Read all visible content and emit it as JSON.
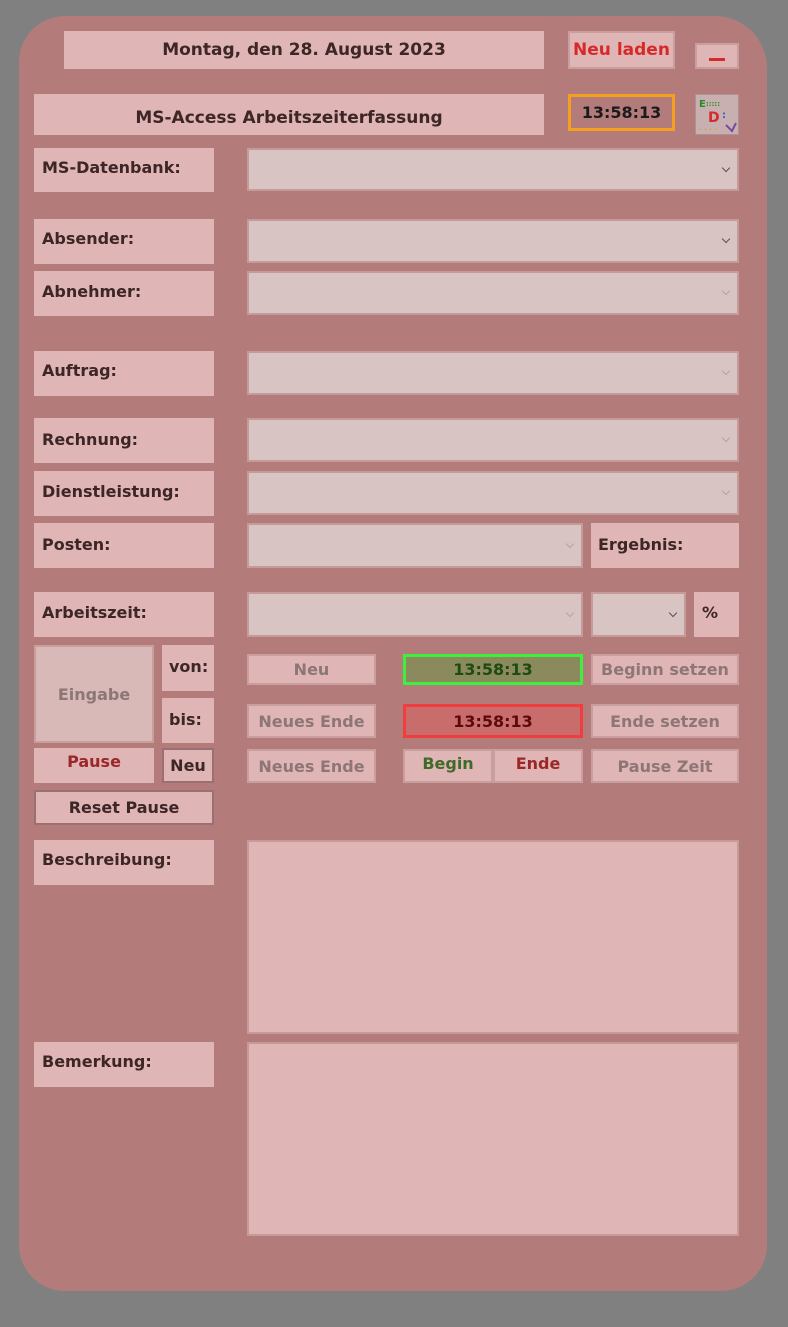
{
  "header": {
    "date_text": "Montag, den 28. August 2023",
    "reload_label": "Neu laden",
    "minimize_label": "—",
    "app_title": "MS-Access Arbeitszeiterfassung",
    "clock": "13:58:13",
    "logo_icon": "form-logo-icon"
  },
  "fields": {
    "database": "MS-Datenbank:",
    "sender": "Absender:",
    "customer": "Abnehmer:",
    "order": "Auftrag:",
    "invoice": "Rechnung:",
    "service": "Dienstleistung:",
    "item": "Posten:",
    "result": "Ergebnis:",
    "worktime": "Arbeitszeit:",
    "percent": "%"
  },
  "time": {
    "input_label": "Eingabe",
    "from_label": "von:",
    "to_label": "bis:",
    "pause_label": "Pause",
    "pause_new_label": "Neu",
    "reset_pause_label": "Reset Pause",
    "new_label": "Neu",
    "new_end_label": "Neues Ende",
    "new_end_label_2": "Neues Ende",
    "start_clock": "13:58:13",
    "end_clock": "13:58:13",
    "begin_label": "Begin",
    "end_label": "Ende",
    "set_begin_label": "Beginn setzen",
    "set_end_label": "Ende setzen",
    "pause_time_label": "Pause Zeit"
  },
  "text": {
    "description_label": "Beschreibung:",
    "remark_label": "Bemerkung:"
  },
  "colors": {
    "panel": "#b47b7b",
    "label_bg": "#e0b5b5",
    "accent_red": "#d62a2a",
    "clock_green_border": "#3ef03e",
    "clock_red_border": "#f03e3e",
    "clock_orange_border": "#f5a01c"
  }
}
